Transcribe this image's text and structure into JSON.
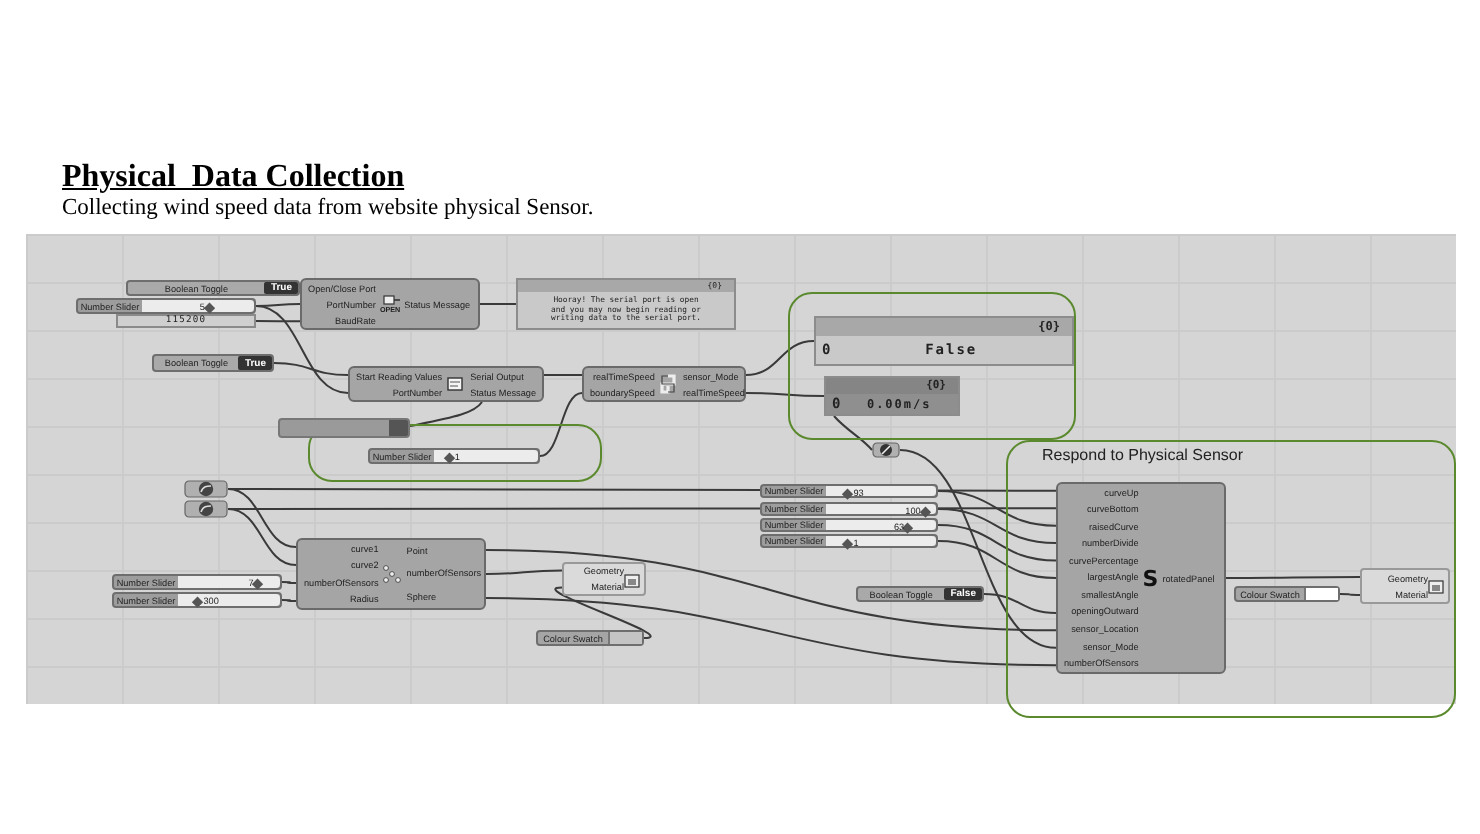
{
  "document": {
    "title": "Physical  Data Collection",
    "subtitle": "Collecting wind speed data from website physical Sensor."
  },
  "canvas": {
    "group_title": "Respond to Physical Sensor",
    "components": [
      {
        "kind": "toggle",
        "label": "Boolean Toggle",
        "value": "True"
      },
      {
        "kind": "slider",
        "label": "Number Slider",
        "value": "5",
        "level": 0.6
      },
      {
        "kind": "value",
        "value": "115200"
      },
      {
        "kind": "component",
        "icon_text": "OPEN",
        "inputs": [
          "Open/Close Port",
          "PortNumber",
          "BaudRate"
        ],
        "outputs": [
          "Status Message"
        ]
      },
      {
        "kind": "panel",
        "header": "{0}",
        "lines": [
          "Hooray! The serial port is open",
          "and you may now begin reading or",
          "writing data to the serial port."
        ]
      },
      {
        "kind": "toggle",
        "label": "Boolean Toggle",
        "value": "True"
      },
      {
        "kind": "component",
        "inputs": [
          "Start Reading Values",
          "PortNumber"
        ],
        "outputs": [
          "Serial Output",
          "Status Message"
        ]
      },
      {
        "kind": "component",
        "inputs": [
          "realTimeSpeed",
          "boundarySpeed"
        ],
        "outputs": [
          "sensor_Mode",
          "realTimeSpeed"
        ]
      },
      {
        "kind": "panel",
        "header": "{0}",
        "index": "0",
        "text": "False"
      },
      {
        "kind": "panel",
        "header": "{0}",
        "index": "0",
        "text": "0.00m/s"
      },
      {
        "kind": "bar"
      },
      {
        "kind": "slider",
        "label": "Number Slider",
        "value": "1",
        "level": 0.15
      },
      {
        "kind": "param"
      },
      {
        "kind": "param"
      },
      {
        "kind": "slider",
        "label": "Number Slider",
        "value": "93",
        "level": 0.2
      },
      {
        "kind": "param"
      },
      {
        "kind": "slider",
        "label": "Number Slider",
        "value": "100",
        "level": 0.9
      },
      {
        "kind": "slider",
        "label": "Number Slider",
        "value": "63",
        "level": 0.75
      },
      {
        "kind": "slider",
        "label": "Number Slider",
        "value": "7",
        "level": 0.78
      },
      {
        "kind": "slider",
        "label": "Number Slider",
        "value": "300",
        "level": 0.2
      },
      {
        "kind": "component",
        "inputs": [
          "curve1",
          "curve2",
          "numberOfSensors",
          "Radius"
        ],
        "outputs": [
          "Point",
          "numberOfSensors",
          "Sphere"
        ]
      },
      {
        "kind": "slider",
        "label": "Number Slider",
        "value": "1",
        "level": 0.2
      },
      {
        "kind": "preview",
        "inputs": [
          "Geometry",
          "Material"
        ]
      },
      {
        "kind": "toggle",
        "label": "Boolean Toggle",
        "value": "False"
      },
      {
        "kind": "swatch",
        "label": "Colour Swatch",
        "color": "#c4c4c4"
      },
      {
        "kind": "component",
        "icon_text": "S",
        "inputs": [
          "curveUp",
          "curveBottom",
          "raisedCurve",
          "numberDivide",
          "curvePercentage",
          "largestAngle",
          "smallestAngle",
          "openingOutward",
          "sensor_Location",
          "sensor_Mode",
          "numberOfSensors"
        ],
        "outputs": [
          "rotatedPanel"
        ]
      },
      {
        "kind": "swatch",
        "label": "Colour Swatch",
        "color": "#ffffff"
      },
      {
        "kind": "preview",
        "inputs": [
          "Geometry",
          "Material"
        ]
      }
    ]
  }
}
